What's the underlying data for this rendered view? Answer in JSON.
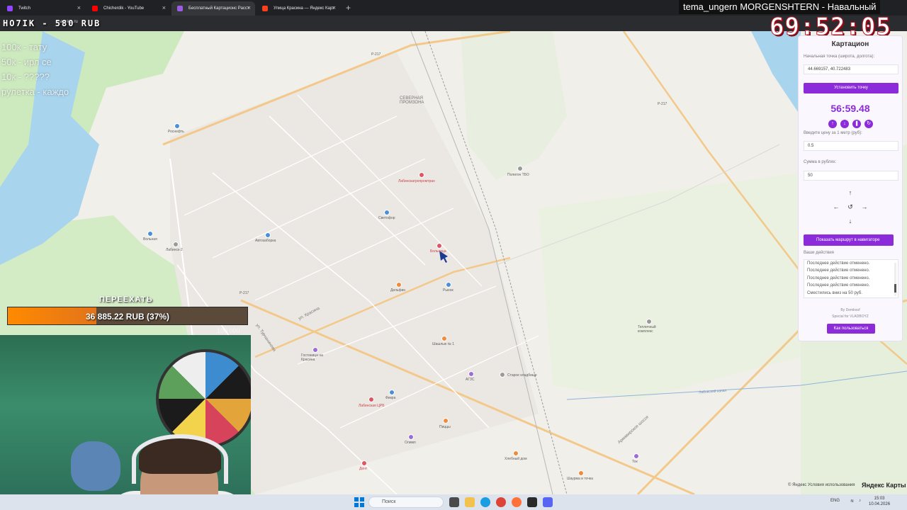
{
  "browser": {
    "tabs": [
      {
        "title": "Twitch",
        "color": "#9146ff"
      },
      {
        "title": "Chicherdik - YouTube",
        "color": "#ff0000"
      },
      {
        "title": "Бесплатный Картационс Расст",
        "color": "#9b5de5"
      },
      {
        "title": "Улица Красина — Яндекс Карт",
        "color": "#fc3f1d"
      }
    ],
    "active_tab": 2,
    "url_fragment": "mapcion.ru"
  },
  "stream": {
    "counter": "НО7ІК - 580 RUB",
    "goal_list": [
      "100к - тату",
      "50к - ирл се",
      "10к - ?????",
      "рулетка - каждо"
    ],
    "title": "tema_ungern MORGENSHTERN - Навальный",
    "timer": "69:52:05",
    "move_label": "ПЕРЕЕХАТЬ",
    "progress_text": "36 885.22 RUB (37%)",
    "progress_fraction": 0.37,
    "progress_max": "100 000"
  },
  "panel": {
    "title": "Картацион",
    "start_label": "Начальная точка (широта, долгота):",
    "start_value": "44.669157, 40.722483",
    "set_point": "Установить точку",
    "time": "56:59.48",
    "price_label": "Введите цену за 1 метр (руб):",
    "price_value": "0.5",
    "sum_label": "Сумма в рублях:",
    "sum_value": "50",
    "nav_button": "Показать маршрут в навигаторе",
    "actions_label": "Ваши действия",
    "log": [
      "Последнее действие отменено.",
      "Последнее действие отменено.",
      "Последнее действие отменено.",
      "Последнее действие отменено.",
      "Сместились вниз на 50 руб."
    ],
    "credit1": "By Demkoof",
    "credit2": "Special for VLADBOYZ",
    "howto": "Как пользоваться"
  },
  "map": {
    "labels": {
      "p217a": "Р-217",
      "p217b": "Р-217",
      "p217c": "Р-217",
      "north": "СЕВЕРНАЯ ПРОМЗОНА",
      "polygon": "Полигон ТБО",
      "labagro": "Лабинскагропромтран",
      "rosneft": "Роснефть",
      "avto": "Автозаборка",
      "svetofor": "Светофор",
      "labinsk2": "Лабинск-2",
      "bolnitsa": "Больница",
      "rynok": "Рынок",
      "dolfin": "Дельфин",
      "shashlyk": "Шашлык № 1",
      "gostinitsa": "Гостиница на Красина",
      "ags": "АГЗС",
      "stary": "Старое кладбище",
      "teplichny": "Тепличный комплекс",
      "labcrb": "Лабинская ЦРБ",
      "fikra": "Фикра",
      "krasina": "ул. Красина",
      "tuchkovsky": "ул. Турчанинова",
      "armavir": "Армавирское шоссе",
      "pizza": "Пиццы",
      "hleb": "Хлебный дом",
      "shauruma": "Шаурма и точка",
      "dent": "Дент",
      "olimp": "Олимп",
      "tok": "Ток",
      "labovsky": "Лабовский канал",
      "vilna": "Вольная"
    },
    "attribution": "© Яндекс Условия использования",
    "logo": "Яндекс Карты"
  },
  "taskbar": {
    "search": "Поиск",
    "lang": "ENG",
    "time": "15:03",
    "date": "10.04.2026"
  }
}
